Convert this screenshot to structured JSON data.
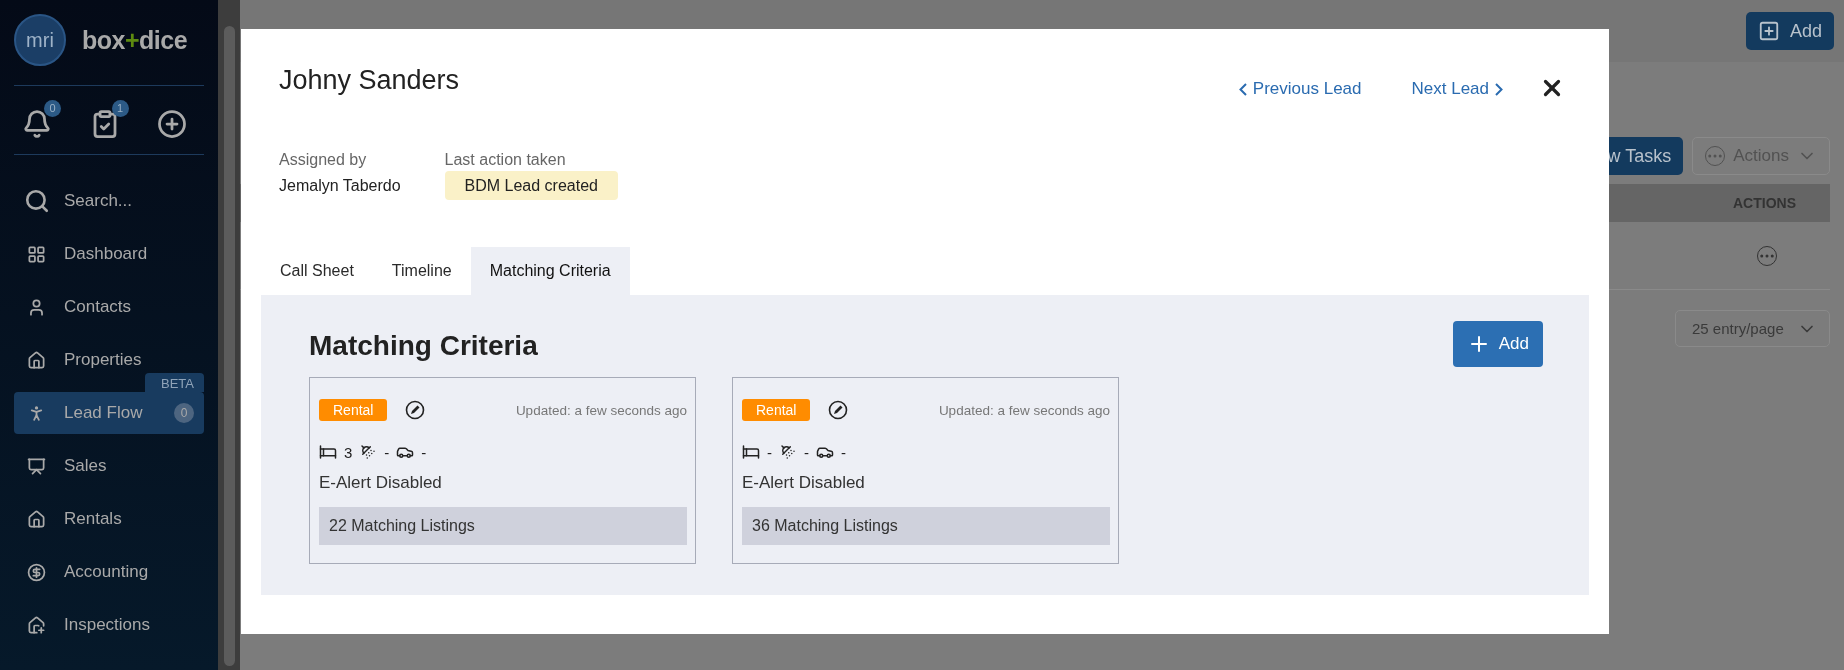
{
  "sidebar": {
    "logo_mark": "mri",
    "brand": [
      "box",
      "+",
      "dice"
    ],
    "quick_actions": [
      {
        "kind": "notifications",
        "count": "0"
      },
      {
        "kind": "tasks",
        "count": "1"
      },
      {
        "kind": "add"
      }
    ],
    "search": {
      "placeholder": "Search..."
    },
    "items": [
      {
        "kind": "dashboard",
        "label": "Dashboard",
        "selected": false
      },
      {
        "kind": "contacts",
        "label": "Contacts",
        "selected": false
      },
      {
        "kind": "properties",
        "label": "Properties",
        "selected": false
      },
      {
        "kind": "leadflow",
        "label": "Lead Flow",
        "selected": true,
        "tag": "BETA",
        "count": "0"
      },
      {
        "kind": "sales",
        "label": "Sales",
        "selected": false
      },
      {
        "kind": "rentals",
        "label": "Rentals",
        "selected": false
      },
      {
        "kind": "accounting",
        "label": "Accounting",
        "selected": false
      },
      {
        "kind": "inspections",
        "label": "Inspections",
        "selected": false
      }
    ]
  },
  "page": {
    "add_button": "Add",
    "tasks_button": "w Tasks",
    "actions_button": "Actions",
    "table": {
      "columns": [
        "ACTIONS"
      ]
    },
    "page_size": "25 entry/page"
  },
  "modal": {
    "title": "Johny Sanders",
    "previous": "Previous Lead",
    "next": "Next Lead",
    "assigned_label": "Assigned by",
    "assigned_value": "Jemalyn Taberdo",
    "last_action_label": "Last action taken",
    "last_action": "BDM Lead created",
    "tabs": [
      {
        "label": "Call Sheet",
        "selected": false
      },
      {
        "label": "Timeline",
        "selected": false
      },
      {
        "label": "Matching Criteria",
        "selected": true
      }
    ],
    "section_title": "Matching Criteria",
    "add_button": "Add",
    "criteria": [
      {
        "type": "Rental",
        "updated": "Updated: a few seconds ago",
        "beds": "3",
        "baths": "-",
        "cars": "-",
        "alert": "E-Alert Disabled",
        "matches": "22 Matching Listings"
      },
      {
        "type": "Rental",
        "updated": "Updated: a few seconds ago",
        "beds": "-",
        "baths": "-",
        "cars": "-",
        "alert": "E-Alert Disabled",
        "matches": "36 Matching Listings"
      }
    ]
  }
}
